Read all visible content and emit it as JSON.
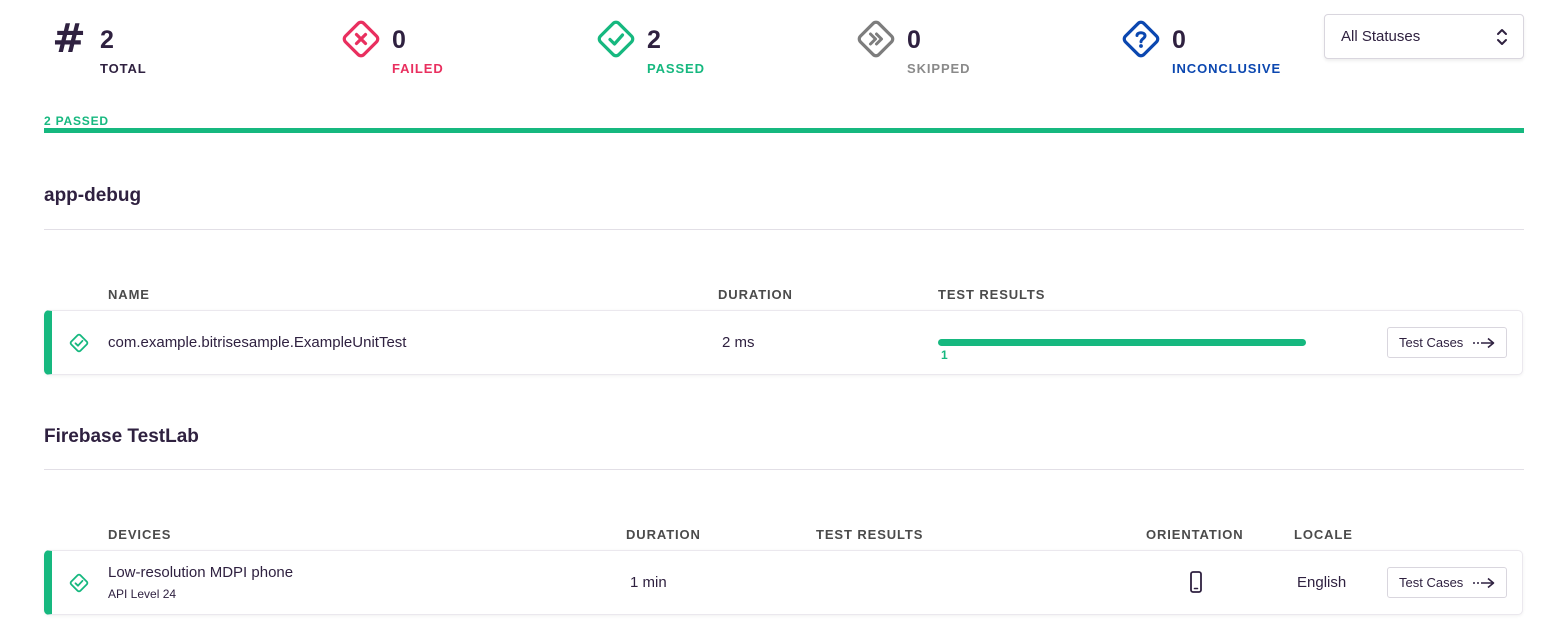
{
  "colors": {
    "text": "#2f2140",
    "failed": "#e92f5f",
    "passed": "#16b87f",
    "skipped": "#8a8a8a",
    "inconclusive": "#0b47b0"
  },
  "summary": {
    "total": {
      "count": "2",
      "label": "TOTAL",
      "icon": "hash-icon",
      "glyph": "#"
    },
    "failed": {
      "count": "0",
      "label": "FAILED",
      "icon": "failed-x-icon"
    },
    "passed": {
      "count": "2",
      "label": "PASSED",
      "icon": "passed-check-icon"
    },
    "skipped": {
      "count": "0",
      "label": "SKIPPED",
      "icon": "skipped-forward-icon"
    },
    "inconclusive": {
      "count": "0",
      "label": "INCONCLUSIVE",
      "icon": "inconclusive-question-icon"
    }
  },
  "status_filter": {
    "selected": "All Statuses"
  },
  "overall": {
    "label": "2 PASSED",
    "passed_fraction": 1.0
  },
  "sections": [
    {
      "title": "app-debug",
      "columns": {
        "name": "NAME",
        "duration": "DURATION",
        "test_results": "TEST RESULTS"
      },
      "rows": [
        {
          "name": "com.example.bitrisesample.ExampleUnitTest",
          "duration": "2 ms",
          "passed_count": "1",
          "passed_fraction": 1.0,
          "button": "Test Cases"
        }
      ]
    },
    {
      "title": "Firebase TestLab",
      "columns": {
        "devices": "DEVICES",
        "duration": "DURATION",
        "test_results": "TEST RESULTS",
        "orientation": "ORIENTATION",
        "locale": "LOCALE"
      },
      "rows": [
        {
          "device": "Low-resolution MDPI phone",
          "api": "API Level 24",
          "duration": "1 min",
          "orientation_icon": "portrait-phone-icon",
          "locale": "English",
          "button": "Test Cases"
        }
      ]
    }
  ]
}
